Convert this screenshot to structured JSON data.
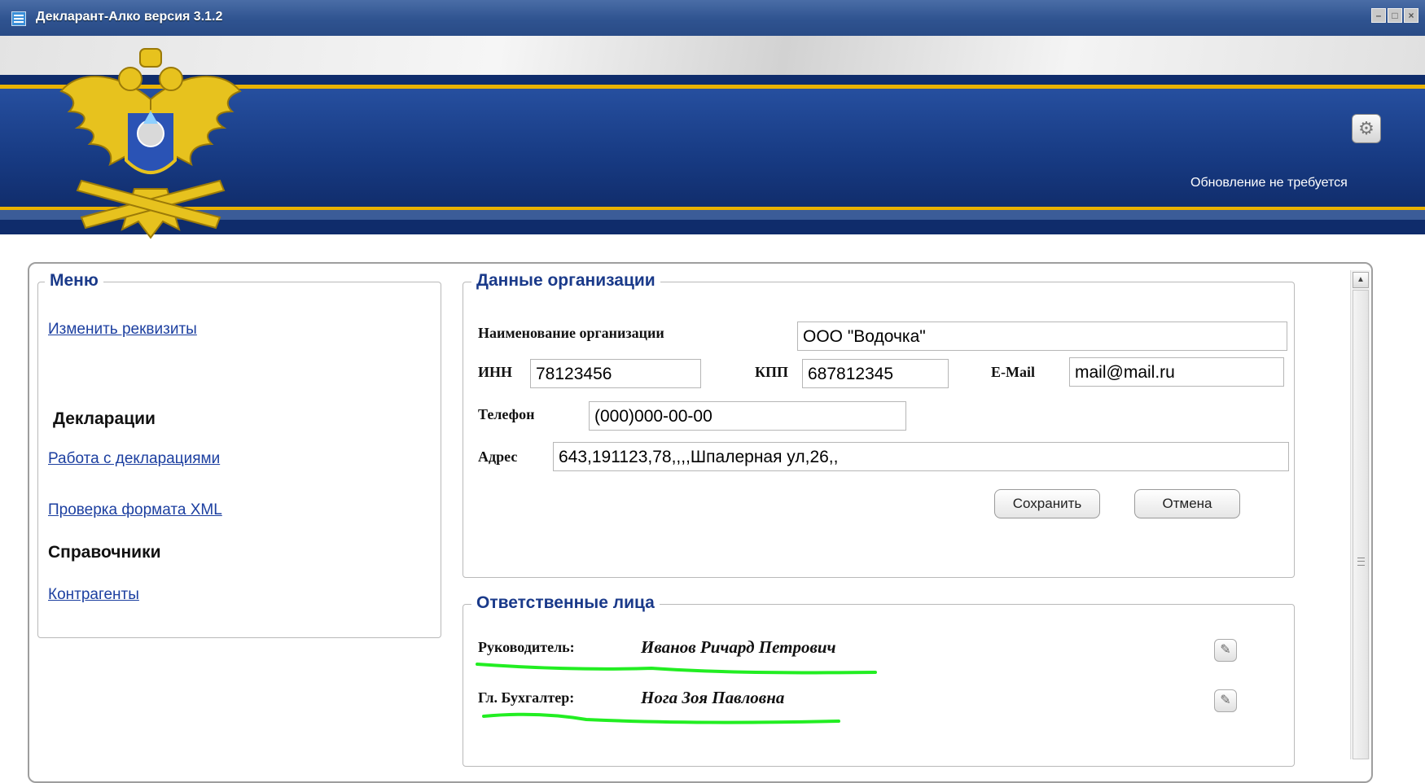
{
  "window": {
    "title": "Декларант-Алко версия 3.1.2"
  },
  "header": {
    "update_status": "Обновление не требуется",
    "settings_icon": "gear-icon"
  },
  "menu": {
    "legend": "Меню",
    "change_requisites": "Изменить реквизиты",
    "declarations_heading": "Декларации",
    "work_with_declarations": "Работа с декларациями",
    "check_xml_format": "Проверка формата XML",
    "references_heading": "Справочники",
    "counterparties": "Контрагенты"
  },
  "org": {
    "legend": "Данные организации",
    "name_label": "Наименование организации",
    "name_value": "ООО \"Водочка\"",
    "inn_label": "ИНН",
    "inn_value": "78123456",
    "kpp_label": "КПП",
    "kpp_value": "687812345",
    "email_label": "E-Mail",
    "email_value": "mail@mail.ru",
    "phone_label": "Телефон",
    "phone_value": "(000)000-00-00",
    "address_label": "Адрес",
    "address_value": "643,191123,78,,,,Шпалерная ул,26,,",
    "save_label": "Сохранить",
    "cancel_label": "Отмена"
  },
  "responsible": {
    "legend": "Ответственные лица",
    "director_label": "Руководитель:",
    "director_name": "Иванов Ричард Петрович",
    "accountant_label": "Гл. Бухгалтер:",
    "accountant_name": "Нога Зоя Павловна"
  },
  "colors": {
    "banner_blue": "#173a82",
    "gold": "#e9b200",
    "link_blue": "#1c3fa0",
    "highlight_green": "#22ee22"
  }
}
